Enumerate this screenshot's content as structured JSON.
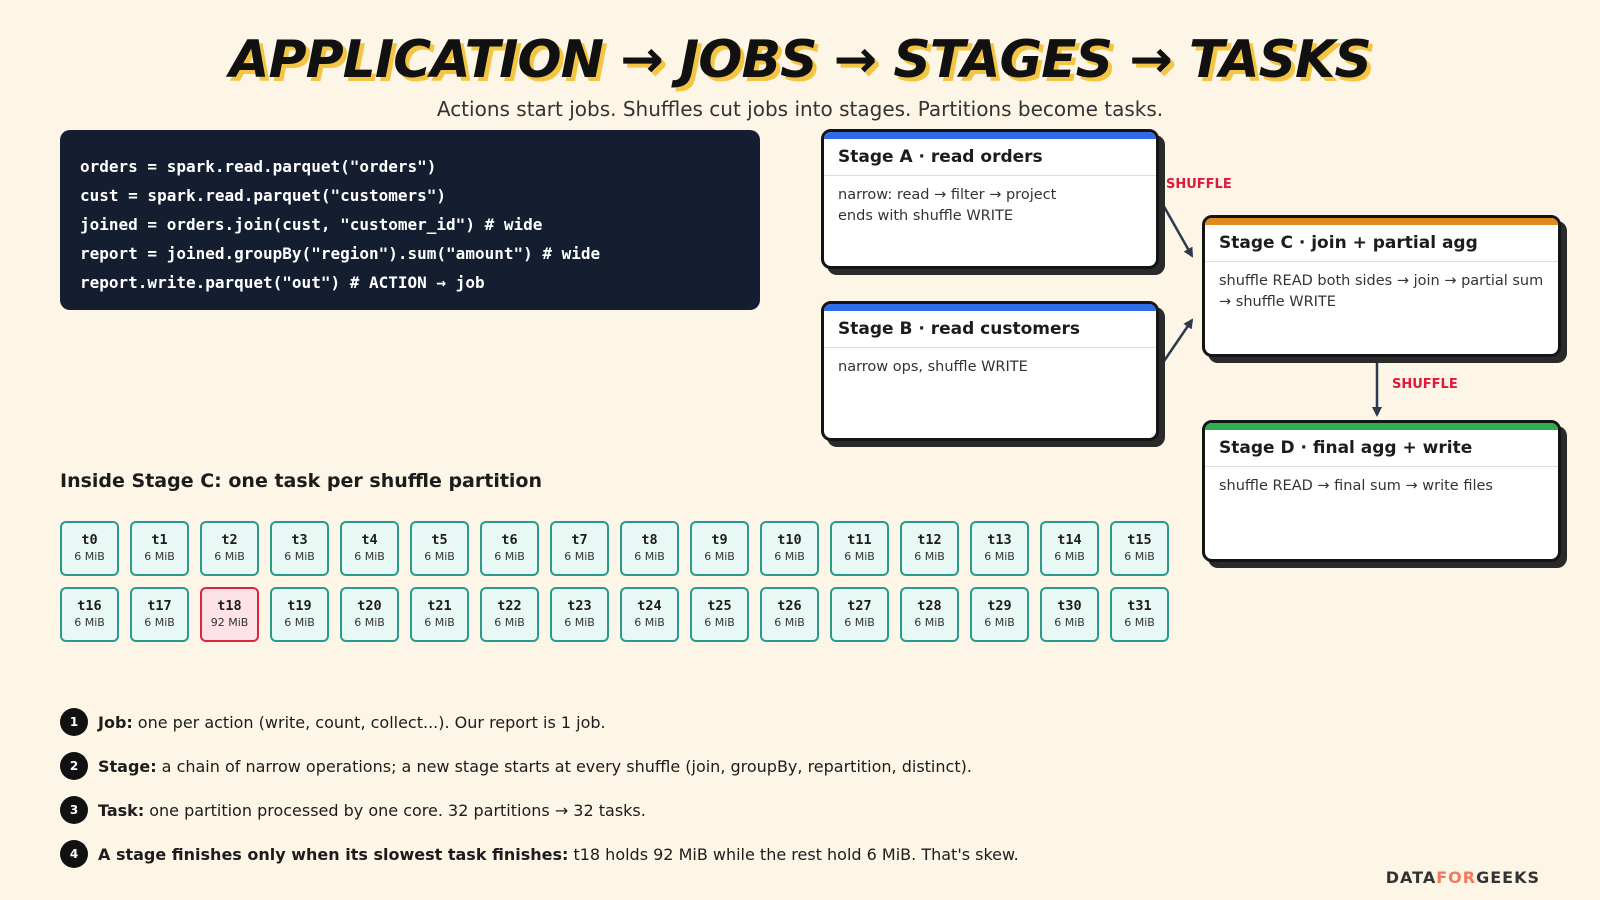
{
  "header": {
    "title": "APPLICATION → JOBS → STAGES → TASKS",
    "subtitle": "Actions start jobs. Shuffles cut jobs into stages. Partitions become tasks."
  },
  "code_lines": [
    "orders = spark.read.parquet(\"orders\")",
    "cust = spark.read.parquet(\"customers\")",
    "joined = orders.join(cust, \"customer_id\") # wide",
    "report = joined.groupBy(\"region\").sum(\"amount\") # wide",
    "report.write.parquet(\"out\") # ACTION → job"
  ],
  "stages": {
    "a": {
      "title": "Stage A · read orders",
      "body1": "narrow: read → filter → project",
      "body2": "ends with shuffle WRITE",
      "color": "#2f6be8"
    },
    "b": {
      "title": "Stage B · read customers",
      "body1": "narrow ops, shuffle WRITE",
      "color": "#2f6be8"
    },
    "c": {
      "title": "Stage C · join + partial agg",
      "body1": "shuffle READ both sides → join → partial sum",
      "body2": "→ shuffle WRITE",
      "color": "#e08a1e"
    },
    "d": {
      "title": "Stage D · final agg + write",
      "body1": "shuffle READ → final sum → write files",
      "color": "#2fae4f"
    }
  },
  "shuffle_labels": {
    "ac": "SHUFFLE",
    "cd": "SHUFFLE"
  },
  "tasks_heading": "Inside Stage C: one task per shuffle partition",
  "tasks": [
    {
      "id": "t0",
      "size": "6 MiB"
    },
    {
      "id": "t1",
      "size": "6 MiB"
    },
    {
      "id": "t2",
      "size": "6 MiB"
    },
    {
      "id": "t3",
      "size": "6 MiB"
    },
    {
      "id": "t4",
      "size": "6 MiB"
    },
    {
      "id": "t5",
      "size": "6 MiB"
    },
    {
      "id": "t6",
      "size": "6 MiB"
    },
    {
      "id": "t7",
      "size": "6 MiB"
    },
    {
      "id": "t8",
      "size": "6 MiB"
    },
    {
      "id": "t9",
      "size": "6 MiB"
    },
    {
      "id": "t10",
      "size": "6 MiB"
    },
    {
      "id": "t11",
      "size": "6 MiB"
    },
    {
      "id": "t12",
      "size": "6 MiB"
    },
    {
      "id": "t13",
      "size": "6 MiB"
    },
    {
      "id": "t14",
      "size": "6 MiB"
    },
    {
      "id": "t15",
      "size": "6 MiB"
    },
    {
      "id": "t16",
      "size": "6 MiB"
    },
    {
      "id": "t17",
      "size": "6 MiB"
    },
    {
      "id": "t18",
      "size": "92 MiB",
      "hot": true
    },
    {
      "id": "t19",
      "size": "6 MiB"
    },
    {
      "id": "t20",
      "size": "6 MiB"
    },
    {
      "id": "t21",
      "size": "6 MiB"
    },
    {
      "id": "t22",
      "size": "6 MiB"
    },
    {
      "id": "t23",
      "size": "6 MiB"
    },
    {
      "id": "t24",
      "size": "6 MiB"
    },
    {
      "id": "t25",
      "size": "6 MiB"
    },
    {
      "id": "t26",
      "size": "6 MiB"
    },
    {
      "id": "t27",
      "size": "6 MiB"
    },
    {
      "id": "t28",
      "size": "6 MiB"
    },
    {
      "id": "t29",
      "size": "6 MiB"
    },
    {
      "id": "t30",
      "size": "6 MiB"
    },
    {
      "id": "t31",
      "size": "6 MiB"
    }
  ],
  "notes": [
    {
      "num": "1",
      "label": "Job:",
      "text": "one per action (write, count, collect...). Our report is 1 job."
    },
    {
      "num": "2",
      "label": "Stage:",
      "text": "a chain of narrow operations; a new stage starts at every shuffle (join, groupBy, repartition, distinct)."
    },
    {
      "num": "3",
      "label": "Task:",
      "text": "one partition processed by one core. 32 partitions → 32 tasks."
    },
    {
      "num": "4",
      "label": "A stage finishes only when its slowest task finishes:",
      "text": "t18 holds 92 MiB while the rest hold 6 MiB. That's skew."
    }
  ],
  "brand": {
    "part1": "DATA",
    "part2": "FOR",
    "part3": "GEEKS"
  }
}
